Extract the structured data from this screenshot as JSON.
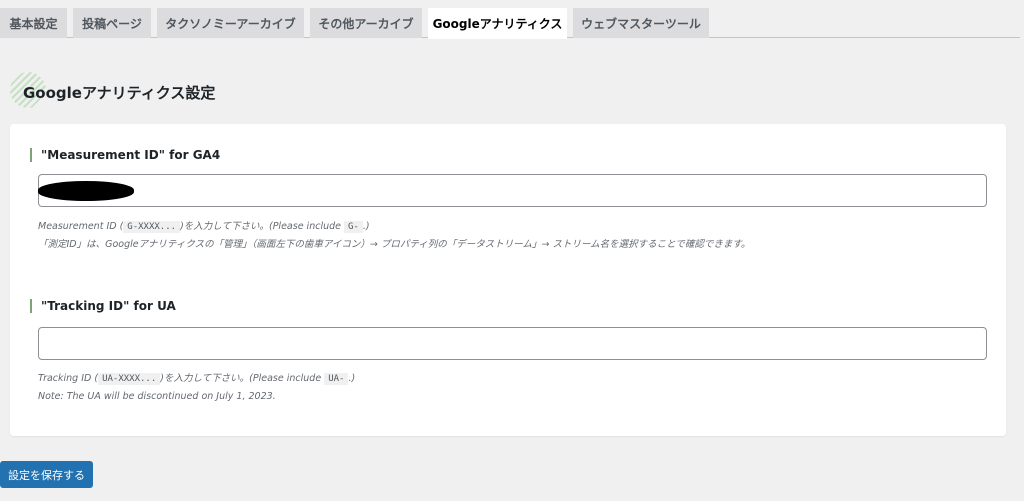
{
  "tabs": [
    {
      "label": "基本設定",
      "active": false
    },
    {
      "label": "投稿ページ",
      "active": false
    },
    {
      "label": "タクソノミーアーカイブ",
      "active": false
    },
    {
      "label": "その他アーカイブ",
      "active": false
    },
    {
      "label": "Googleアナリティクス",
      "active": true
    },
    {
      "label": "ウェブマスターツール",
      "active": false
    }
  ],
  "page": {
    "title": "Googleアナリティクス設定"
  },
  "ga4": {
    "label": "\"Measurement ID\" for GA4",
    "value": "",
    "desc1_pre": "Measurement ID (",
    "desc1_code": "G-XXXX...",
    "desc1_mid": ")を入力して下さい。(Please include ",
    "desc1_code2": "G-",
    "desc1_post": ".)",
    "desc2": "「測定ID」は、Googleアナリティクスの「管理」（画面左下の歯車アイコン）→ プロパティ列の「データストリーム」→ ストリーム名を選択することで確認できます。"
  },
  "ua": {
    "label": "\"Tracking ID\" for UA",
    "value": "",
    "desc1_pre": "Tracking ID (",
    "desc1_code": "UA-XXXX...",
    "desc1_mid": ")を入力して下さい。(Please include ",
    "desc1_code2": "UA-",
    "desc1_post": ".)",
    "desc2": "Note: The UA will be discontinued on July 1, 2023."
  },
  "save_button": "設定を保存する",
  "colors": {
    "accent": "#2271b1",
    "label_bar": "#7fa277",
    "background": "#f0f0f1"
  }
}
